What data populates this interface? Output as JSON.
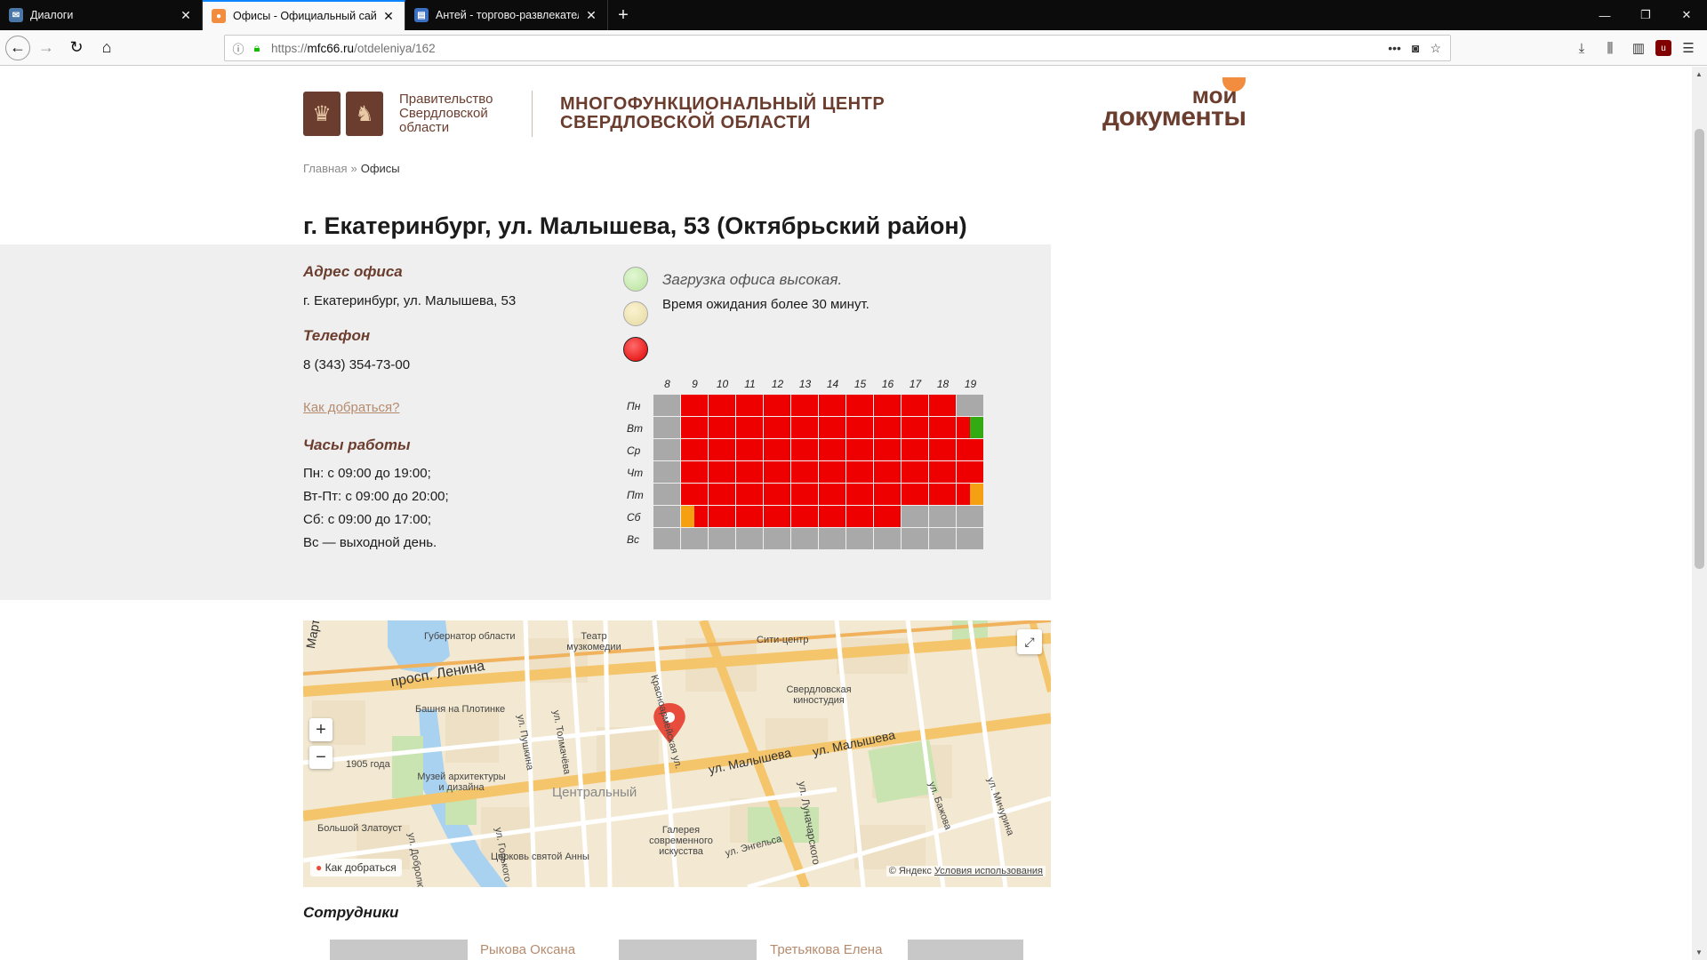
{
  "browser": {
    "tabs": [
      {
        "title": "Диалоги",
        "icon": "chat-icon"
      },
      {
        "title": "Офисы - Официальный сайт МФ",
        "icon": "mfc-icon"
      },
      {
        "title": "Антей - торгово-развлекатель",
        "icon": "page-icon"
      }
    ],
    "url_prefix": "https://",
    "url_host": "mfc66.ru",
    "url_path": "/otdeleniya/162"
  },
  "header": {
    "gov_line1": "Правительство",
    "gov_line2": "Свердловской",
    "gov_line3": "области",
    "mfc_line1": "МНОГОФУНКЦИОНАЛЬНЫЙ ЦЕНТР",
    "mfc_line2": "СВЕРДЛОВСКОЙ ОБЛАСТИ",
    "brand_line1": "мои",
    "brand_line2": "документы"
  },
  "breadcrumb": {
    "home": "Главная",
    "sep": "»",
    "current": "Офисы"
  },
  "office": {
    "title": "г. Екатеринбург, ул. Малышева, 53 (Октябрьский район)",
    "address_label": "Адрес офиса",
    "address": "г. Екатеринбург, ул. Малышева, 53",
    "phone_label": "Телефон",
    "phone": "8 (343) 354-73-00",
    "directions_link": "Как добраться?",
    "hours_label": "Часы работы",
    "hours": [
      "Пн: с 09:00 до 19:00;",
      "Вт-Пт: с 09:00 до 20:00;",
      "Сб: с 09:00 до 17:00;",
      "Вс — выходной день."
    ]
  },
  "load": {
    "status_text": "Загрузка офиса высокая.",
    "wait_text": "Время ожидания более 30 минут.",
    "colors": {
      "red": "#ee0000",
      "gray": "#a9a9a9",
      "green": "#33aa11",
      "orange": "#f5a012"
    },
    "hours": [
      "8",
      "9",
      "10",
      "11",
      "12",
      "13",
      "14",
      "15",
      "16",
      "17",
      "18",
      "19"
    ],
    "days": [
      "Пн",
      "Вт",
      "Ср",
      "Чт",
      "Пт",
      "Сб",
      "Вс"
    ],
    "grid": [
      [
        "gray",
        "red",
        "red",
        "red",
        "red",
        "red",
        "red",
        "red",
        "red",
        "red",
        "red",
        "gray"
      ],
      [
        "gray",
        "red",
        "red",
        "red",
        "red",
        "red",
        "red",
        "red",
        "red",
        "red",
        "red",
        "red-green"
      ],
      [
        "gray",
        "red",
        "red",
        "red",
        "red",
        "red",
        "red",
        "red",
        "red",
        "red",
        "red",
        "red"
      ],
      [
        "gray",
        "red",
        "red",
        "red",
        "red",
        "red",
        "red",
        "red",
        "red",
        "red",
        "red",
        "red"
      ],
      [
        "gray",
        "red",
        "red",
        "red",
        "red",
        "red",
        "red",
        "red",
        "red",
        "red",
        "red",
        "red-orange"
      ],
      [
        "gray",
        "orange-red",
        "red",
        "red",
        "red",
        "red",
        "red",
        "red",
        "red",
        "gray",
        "gray",
        "gray"
      ],
      [
        "gray",
        "gray",
        "gray",
        "gray",
        "gray",
        "gray",
        "gray",
        "gray",
        "gray",
        "gray",
        "gray",
        "gray"
      ]
    ]
  },
  "map": {
    "labels": {
      "marta": "Марта",
      "governor": "Губернатор области",
      "theater": "Театр музкомедии",
      "city_center": "Сити-центр",
      "lenina": "просп. Ленина",
      "tower": "Башня на Плотинке",
      "kinostudia": "Свердловская киностудия",
      "krasnoarm": "Красноармейская ул.",
      "pushkina": "ул. Пушкина",
      "tolmacheva": "ул. Толмачёва",
      "malysheva1": "ул. Малышева",
      "malysheva2": "ул. Малышева",
      "year1905": "1905 года",
      "museum": "Музей архитектуры и дизайна",
      "central": "Центральный",
      "lunach": "ул. Луначарского",
      "bazhova": "ул. Бажова",
      "michurina": "ул. Мичурина",
      "zlatoust": "Большой Златоуст",
      "gorkogo": "ул. Горького",
      "anna": "Церковь святой Анны",
      "gallery": "Галерея современного искусства",
      "engelsa": "ул. Энгельса",
      "dobrolyub": "ул. Добролюбова"
    },
    "route_link": "Как добраться",
    "copyright": "© Яндекс",
    "terms": "Условия использования"
  },
  "staff": {
    "title": "Сотрудники",
    "people": [
      "Рыкова Оксана",
      "Третьякова Елена"
    ]
  }
}
